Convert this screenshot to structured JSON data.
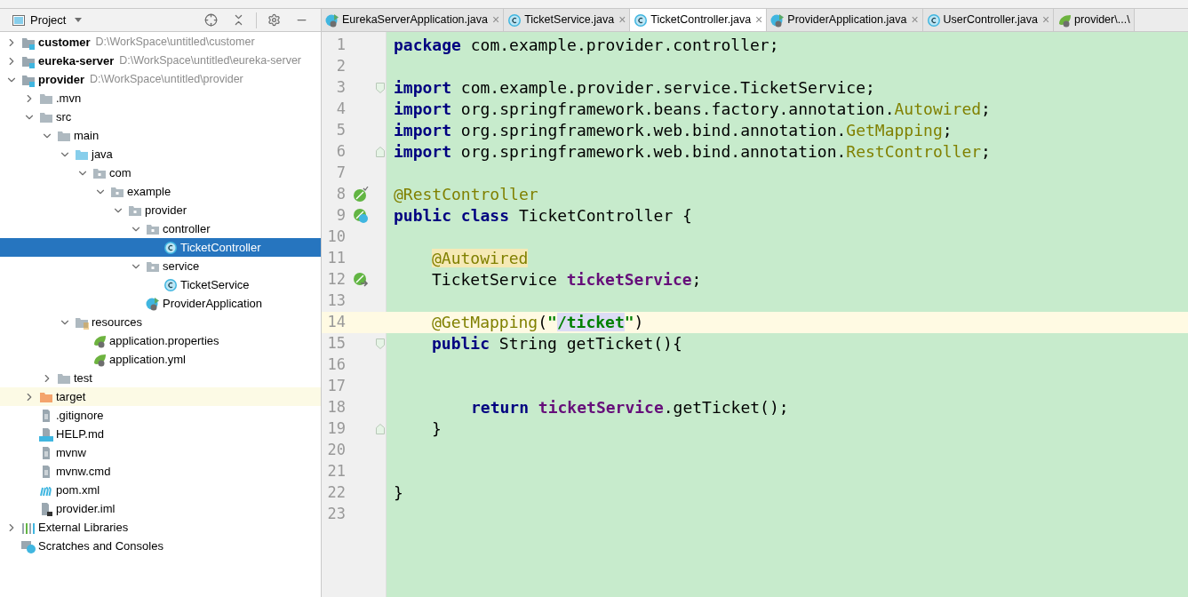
{
  "project_panel": {
    "title": "Project",
    "tree": [
      {
        "label": "customer",
        "path": "D:\\WorkSpace\\untitled\\customer",
        "kind": "module",
        "expanded": false,
        "selected": false
      },
      {
        "label": "eureka-server",
        "path": "D:\\WorkSpace\\untitled\\eureka-server",
        "kind": "module",
        "expanded": false,
        "selected": false
      },
      {
        "label": "provider",
        "path": "D:\\WorkSpace\\untitled\\provider",
        "kind": "module",
        "expanded": true,
        "selected": false,
        "children": [
          {
            "label": ".mvn",
            "kind": "folder",
            "expanded": false,
            "selected": false
          },
          {
            "label": "src",
            "kind": "folder",
            "expanded": true,
            "selected": false,
            "children": [
              {
                "label": "main",
                "kind": "folder",
                "expanded": true,
                "selected": false,
                "children": [
                  {
                    "label": "java",
                    "kind": "source",
                    "expanded": true,
                    "selected": false,
                    "children": [
                      {
                        "label": "com",
                        "kind": "package",
                        "expanded": true,
                        "selected": false,
                        "children": [
                          {
                            "label": "example",
                            "kind": "package",
                            "expanded": true,
                            "selected": false,
                            "children": [
                              {
                                "label": "provider",
                                "kind": "package",
                                "expanded": true,
                                "selected": false,
                                "children": [
                                  {
                                    "label": "controller",
                                    "kind": "package",
                                    "expanded": true,
                                    "selected": false,
                                    "children": [
                                      {
                                        "label": "TicketController",
                                        "kind": "class",
                                        "selected": true
                                      }
                                    ]
                                  },
                                  {
                                    "label": "service",
                                    "kind": "package",
                                    "expanded": true,
                                    "selected": false,
                                    "children": [
                                      {
                                        "label": "TicketService",
                                        "kind": "class",
                                        "selected": false
                                      }
                                    ]
                                  },
                                  {
                                    "label": "ProviderApplication",
                                    "kind": "boot",
                                    "selected": false
                                  }
                                ]
                              }
                            ]
                          }
                        ]
                      }
                    ]
                  },
                  {
                    "label": "resources",
                    "kind": "resources",
                    "expanded": true,
                    "selected": false,
                    "children": [
                      {
                        "label": "application.properties",
                        "kind": "spring",
                        "selected": false
                      },
                      {
                        "label": "application.yml",
                        "kind": "spring",
                        "selected": false
                      }
                    ]
                  }
                ]
              },
              {
                "label": "test",
                "kind": "folder",
                "expanded": false,
                "selected": false
              }
            ]
          },
          {
            "label": "target",
            "kind": "excluded",
            "expanded": false,
            "selected": false,
            "highlighted": true
          },
          {
            "label": ".gitignore",
            "kind": "text",
            "selected": false
          },
          {
            "label": "HELP.md",
            "kind": "markdown",
            "selected": false
          },
          {
            "label": "mvnw",
            "kind": "text",
            "selected": false
          },
          {
            "label": "mvnw.cmd",
            "kind": "text",
            "selected": false
          },
          {
            "label": "pom.xml",
            "kind": "maven",
            "selected": false
          },
          {
            "label": "provider.iml",
            "kind": "iml",
            "selected": false
          }
        ]
      },
      {
        "label": "External Libraries",
        "kind": "libraries",
        "expanded": false,
        "selected": false
      },
      {
        "label": "Scratches and Consoles",
        "kind": "scratches",
        "selected": false
      }
    ]
  },
  "editor": {
    "tabs": [
      {
        "label": "EurekaServerApplication.java",
        "kind": "boot",
        "close": "×",
        "selected": false
      },
      {
        "label": "TicketService.java",
        "kind": "class",
        "close": "×",
        "selected": false
      },
      {
        "label": "TicketController.java",
        "kind": "class",
        "close": "×",
        "selected": true
      },
      {
        "label": "ProviderApplication.java",
        "kind": "boot",
        "close": "×",
        "selected": false
      },
      {
        "label": "UserController.java",
        "kind": "class",
        "close": "×",
        "selected": false
      },
      {
        "label": "provider\\...\\",
        "kind": "spring",
        "selected": false
      }
    ],
    "lines": [
      {
        "number": "1",
        "kind": "top",
        "current": false,
        "segments": [
          {
            "text": "package ",
            "kind": "keyword"
          },
          {
            "text": "com.example.provider.controller;",
            "kind": "plain"
          }
        ]
      },
      {
        "number": "2",
        "current": false
      },
      {
        "number": "3",
        "kind": "top",
        "current": false,
        "fold": {
          "kind": "start"
        },
        "segments": [
          {
            "text": "import ",
            "kind": "keyword"
          },
          {
            "text": "com.example.provider.service.TicketService;",
            "kind": "plain"
          }
        ]
      },
      {
        "number": "4",
        "kind": "top",
        "current": false,
        "segments": [
          {
            "text": "import ",
            "kind": "keyword"
          },
          {
            "text": "org.springframework.beans.factory.annotation.",
            "kind": "plain"
          },
          {
            "text": "Autowired",
            "kind": "annotation"
          },
          {
            "text": ";",
            "kind": "plain"
          }
        ]
      },
      {
        "number": "5",
        "kind": "top",
        "current": false,
        "segments": [
          {
            "text": "import ",
            "kind": "keyword"
          },
          {
            "text": "org.springframework.web.bind.annotation.",
            "kind": "plain"
          },
          {
            "text": "GetMapping",
            "kind": "annotation"
          },
          {
            "text": ";",
            "kind": "plain"
          }
        ]
      },
      {
        "number": "6",
        "kind": "top",
        "current": false,
        "fold": {
          "kind": "end"
        },
        "segments": [
          {
            "text": "import ",
            "kind": "keyword"
          },
          {
            "text": "org.springframework.web.bind.annotation.",
            "kind": "plain"
          },
          {
            "text": "RestController",
            "kind": "annotation"
          },
          {
            "text": ";",
            "kind": "plain"
          }
        ]
      },
      {
        "number": "7",
        "current": false
      },
      {
        "number": "8",
        "kind": "top",
        "current": false,
        "marker": {
          "kind": "bean"
        },
        "segments": [
          {
            "text": "@RestController",
            "kind": "annotation"
          }
        ]
      },
      {
        "number": "9",
        "kind": "top",
        "current": false,
        "marker": {
          "kind": "bean_class"
        },
        "segments": [
          {
            "text": "public class ",
            "kind": "keyword"
          },
          {
            "text": "TicketController {",
            "kind": "plain"
          }
        ]
      },
      {
        "number": "10",
        "current": false
      },
      {
        "number": "11",
        "kind": "member",
        "current": false,
        "segments": [
          {
            "text": "@Autowired",
            "kind": "annotation",
            "highlighted": true
          }
        ]
      },
      {
        "number": "12",
        "kind": "member",
        "current": false,
        "marker": {
          "kind": "bean_link"
        },
        "segments": [
          {
            "text": "TicketService ",
            "kind": "plain"
          },
          {
            "text": "ticketService",
            "kind": "field"
          },
          {
            "text": ";",
            "kind": "plain"
          }
        ]
      },
      {
        "number": "13",
        "current": false
      },
      {
        "number": "14",
        "kind": "member",
        "current": true,
        "segments": [
          {
            "text": "@GetMapping",
            "kind": "annotation"
          },
          {
            "text": "(",
            "kind": "plain"
          },
          {
            "text": "\"",
            "kind": "string"
          },
          {
            "text": "/ticket",
            "kind": "string",
            "highlighted": true
          },
          {
            "text": "\"",
            "kind": "string"
          },
          {
            "text": ")",
            "kind": "plain"
          }
        ]
      },
      {
        "number": "15",
        "kind": "member",
        "current": false,
        "fold": {
          "kind": "start"
        },
        "segments": [
          {
            "text": "public ",
            "kind": "keyword"
          },
          {
            "text": "String getTicket(){",
            "kind": "plain"
          }
        ]
      },
      {
        "number": "16",
        "current": false
      },
      {
        "number": "17",
        "current": false
      },
      {
        "number": "18",
        "kind": "statement",
        "current": false,
        "segments": [
          {
            "text": "return ",
            "kind": "keyword"
          },
          {
            "text": "ticketService",
            "kind": "field"
          },
          {
            "text": ".getTicket();",
            "kind": "plain"
          }
        ]
      },
      {
        "number": "19",
        "kind": "member",
        "current": false,
        "fold": {
          "kind": "end"
        },
        "segments": [
          {
            "text": "}",
            "kind": "plain"
          }
        ]
      },
      {
        "number": "20",
        "current": false
      },
      {
        "number": "21",
        "current": false
      },
      {
        "number": "22",
        "kind": "top",
        "current": false,
        "segments": [
          {
            "text": "}",
            "kind": "plain"
          }
        ]
      },
      {
        "number": "23",
        "current": false
      }
    ]
  }
}
